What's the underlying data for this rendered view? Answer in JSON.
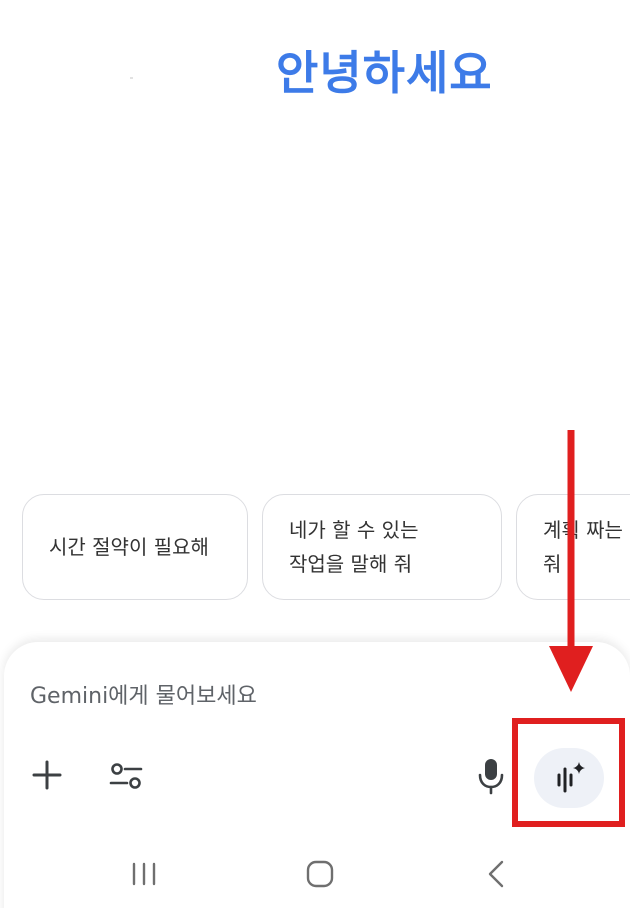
{
  "header": {
    "greeting": "안녕하세요"
  },
  "suggestions": [
    {
      "text": "시간 절약이 필요해"
    },
    {
      "text": "네가 할 수 있는\n작업을 말해 줘"
    },
    {
      "text": "계획 짜는\n줘"
    }
  ],
  "composer": {
    "placeholder": "Gemini에게 물어보세요"
  },
  "icons": {
    "add": "plus-icon",
    "tools": "tools-icon",
    "mic": "mic-icon",
    "live": "gemini-live-icon"
  },
  "annotation": {
    "color": "#e01f1f"
  },
  "nav": {
    "recent": "recent-apps-icon",
    "home": "home-icon",
    "back": "back-icon"
  },
  "colors": {
    "greeting": "#3d7be8",
    "live_button_bg": "#eef1f7"
  }
}
